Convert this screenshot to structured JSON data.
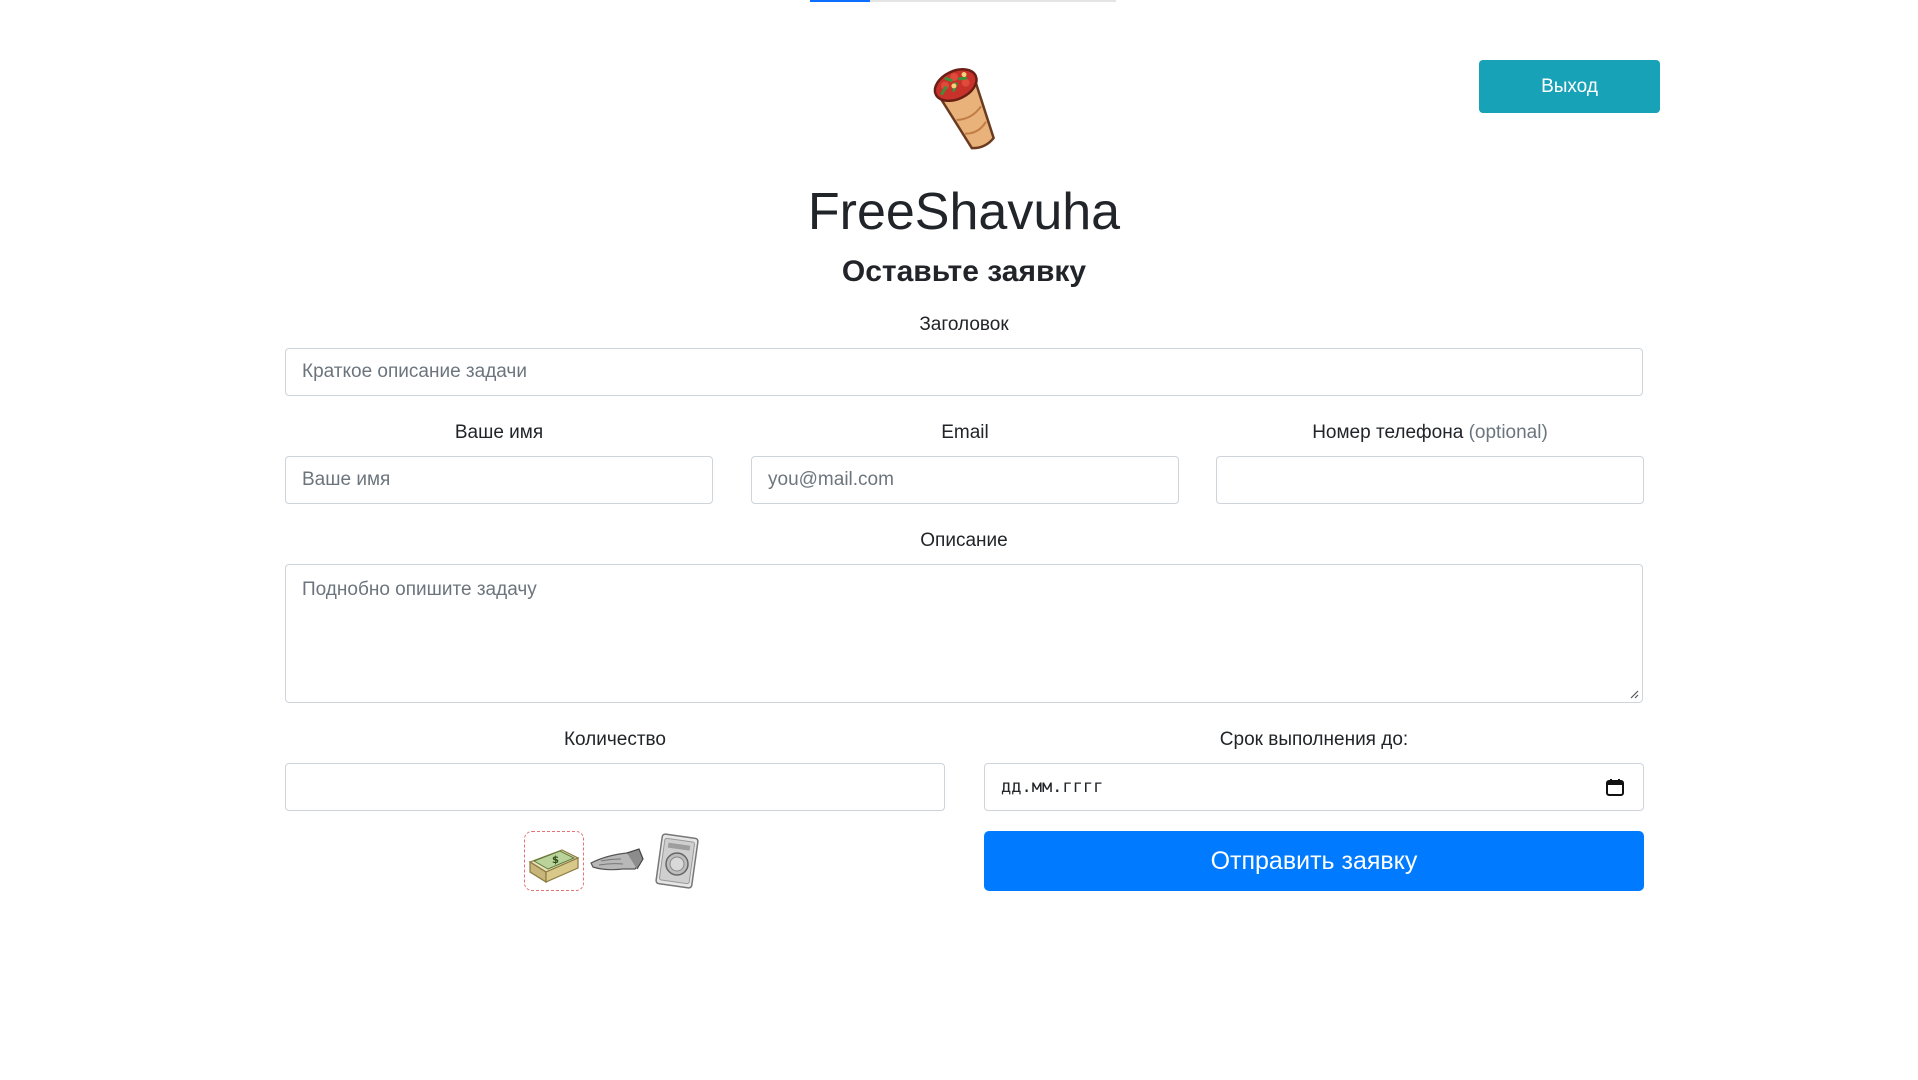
{
  "header": {
    "logout_label": "Выход",
    "brand": "FreeShavuha",
    "subtitle": "Оставьте заявку",
    "logo_icon": "shawarma-icon"
  },
  "form": {
    "title_field": {
      "label": "Заголовок",
      "placeholder": "Краткое описание задачи"
    },
    "name_field": {
      "label": "Ваше имя",
      "placeholder": "Ваше имя"
    },
    "email_field": {
      "label": "Email",
      "placeholder": "you@mail.com"
    },
    "phone_field": {
      "label": "Номер телефона",
      "optional": "(optional)",
      "value": ""
    },
    "description_field": {
      "label": "Описание",
      "placeholder": "Поднобно опишите задачу"
    },
    "quantity_field": {
      "label": "Количество",
      "value": ""
    },
    "deadline_field": {
      "label": "Срок выполнения до:",
      "placeholder": "дд.мм.гггг",
      "icon": "calendar-icon"
    },
    "payment_options": [
      {
        "icon": "cash-money-icon",
        "selected": true
      },
      {
        "icon": "shawarma-roll-icon",
        "selected": false
      },
      {
        "icon": "silver-coin-icon",
        "selected": false
      }
    ],
    "submit_label": "Отправить заявку"
  },
  "colors": {
    "logout_button": "#17a2b8",
    "submit_button": "#007bff",
    "selected_border": "#e57373"
  }
}
